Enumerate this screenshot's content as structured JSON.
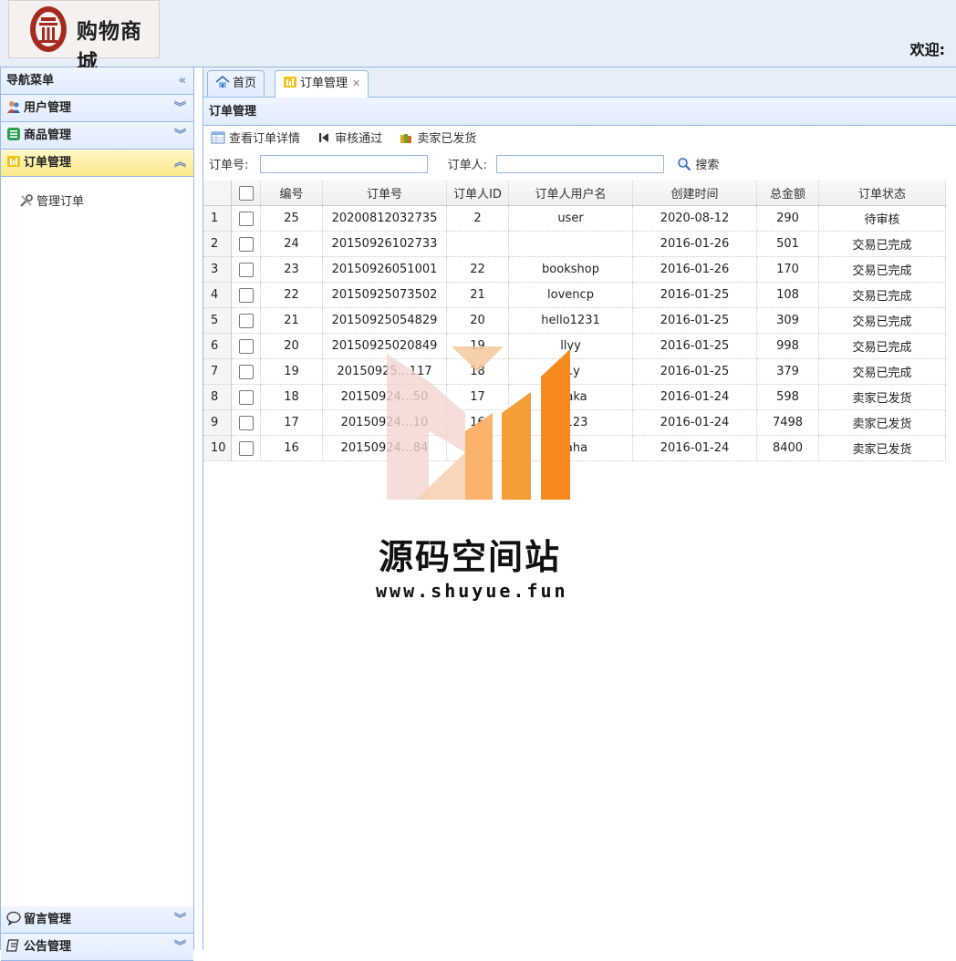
{
  "header": {
    "logo_text": "购物商城",
    "welcome": "欢迎:"
  },
  "sidebar": {
    "title": "导航菜单",
    "sections": [
      {
        "label": "用户管理",
        "icon": "users-icon"
      },
      {
        "label": "商品管理",
        "icon": "goods-icon"
      },
      {
        "label": "订单管理",
        "icon": "order-icon",
        "active": true
      }
    ],
    "tree_item": "管理订单",
    "bottom_sections": [
      {
        "label": "留言管理",
        "icon": "comment-icon"
      },
      {
        "label": "公告管理",
        "icon": "notice-icon"
      }
    ]
  },
  "tabs": [
    {
      "label": "首页",
      "icon": "home-icon"
    },
    {
      "label": "订单管理",
      "icon": "order-icon",
      "selected": true
    }
  ],
  "grid": {
    "title": "订单管理",
    "toolbar": [
      "查看订单详情",
      "审核通过",
      "卖家已发货"
    ],
    "search": {
      "order_no_label": "订单号:",
      "orderer_label": "订单人:",
      "order_no_value": "",
      "orderer_value": "",
      "button": "搜索"
    },
    "columns": [
      "编号",
      "订单号",
      "订单人ID",
      "订单人用户名",
      "创建时间",
      "总金额",
      "订单状态"
    ],
    "rows": [
      {
        "n": "1",
        "id": "25",
        "no": "20200812032735",
        "uid": "2",
        "uname": "user",
        "time": "2020-08-12",
        "total": "290",
        "status": "待审核"
      },
      {
        "n": "2",
        "id": "24",
        "no": "20150926102733",
        "uid": "",
        "uname": "",
        "time": "2016-01-26",
        "total": "501",
        "status": "交易已完成"
      },
      {
        "n": "3",
        "id": "23",
        "no": "20150926051001",
        "uid": "22",
        "uname": "bookshop",
        "time": "2016-01-26",
        "total": "170",
        "status": "交易已完成"
      },
      {
        "n": "4",
        "id": "22",
        "no": "20150925073502",
        "uid": "21",
        "uname": "lovencp",
        "time": "2016-01-25",
        "total": "108",
        "status": "交易已完成"
      },
      {
        "n": "5",
        "id": "21",
        "no": "20150925054829",
        "uid": "20",
        "uname": "hello1231",
        "time": "2016-01-25",
        "total": "309",
        "status": "交易已完成"
      },
      {
        "n": "6",
        "id": "20",
        "no": "20150925020849",
        "uid": "19",
        "uname": "llyy",
        "time": "2016-01-25",
        "total": "998",
        "status": "交易已完成"
      },
      {
        "n": "7",
        "id": "19",
        "no": "20150925…117",
        "uid": "18",
        "uname": "…y",
        "time": "2016-01-25",
        "total": "379",
        "status": "交易已完成"
      },
      {
        "n": "8",
        "id": "18",
        "no": "20150924…50",
        "uid": "17",
        "uname": "…aka",
        "time": "2016-01-24",
        "total": "598",
        "status": "卖家已发货"
      },
      {
        "n": "9",
        "id": "17",
        "no": "20150924…10",
        "uid": "16",
        "uname": "…123",
        "time": "2016-01-24",
        "total": "7498",
        "status": "卖家已发货"
      },
      {
        "n": "10",
        "id": "16",
        "no": "20150924…84",
        "uid": "",
        "uname": "…aha",
        "time": "2016-01-24",
        "total": "8400",
        "status": "卖家已发货"
      }
    ]
  },
  "watermark": {
    "title": "源码空间站",
    "url": "www.shuyue.fun"
  },
  "colors": {
    "border": "#95b8e7",
    "header_bg": "#e6eef8",
    "active_section": "#fbe889",
    "watermark_orange": "#f68a1e"
  }
}
